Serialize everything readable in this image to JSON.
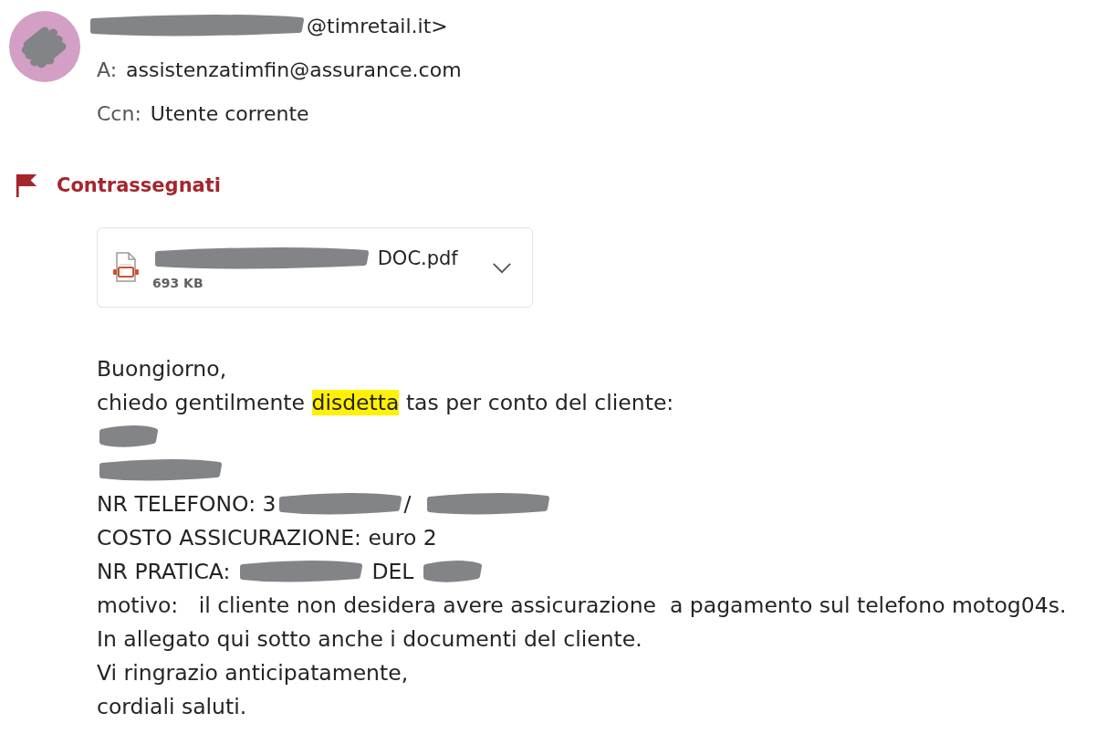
{
  "header": {
    "avatar": {
      "color": "#d39fc4",
      "redacted": true
    },
    "from": [
      {
        "kind": "redaction-long"
      },
      {
        "kind": "text",
        "text": "@timretail.it>"
      }
    ],
    "recipients": [
      {
        "label": "A:",
        "value": "assistenzatimfin@assurance.com"
      },
      {
        "label": "Ccn:",
        "value": "Utente corrente"
      }
    ]
  },
  "flag": {
    "label": "Contrassegnati",
    "color": "#a4262c"
  },
  "attachment": {
    "name": [
      {
        "kind": "redaction-long"
      },
      {
        "kind": "text",
        "text": " DOC.pdf"
      }
    ],
    "size": "693 KB"
  },
  "body": [
    {
      "segments": [
        {
          "kind": "text",
          "text": "Buongiorno,"
        }
      ]
    },
    {
      "segments": [
        {
          "kind": "text",
          "text": "chiedo gentilmente "
        },
        {
          "kind": "highlight",
          "text": "disdetta"
        },
        {
          "kind": "text",
          "text": " tas per conto del cliente:"
        }
      ]
    },
    {
      "segments": [
        {
          "kind": "redaction-short"
        }
      ]
    },
    {
      "segments": [
        {
          "kind": "redaction-medium"
        }
      ]
    },
    {
      "segments": [
        {
          "kind": "text",
          "text": "NR TELEFONO: 3"
        },
        {
          "kind": "redaction-medium"
        },
        {
          "kind": "text",
          "text": "/  "
        },
        {
          "kind": "redaction-medium"
        }
      ]
    },
    {
      "segments": [
        {
          "kind": "text",
          "text": "COSTO ASSICURAZIONE: euro 2"
        }
      ]
    },
    {
      "segments": [
        {
          "kind": "text",
          "text": "NR PRATICA: "
        },
        {
          "kind": "redaction-medium"
        },
        {
          "kind": "text",
          "text": " DEL "
        },
        {
          "kind": "redaction-short"
        }
      ]
    },
    {
      "segments": [
        {
          "kind": "text",
          "text": "motivo:   il cliente non desidera avere assicurazione  a pagamento sul telefono motog04s."
        }
      ]
    },
    {
      "segments": [
        {
          "kind": "text",
          "text": "In allegato qui sotto anche i documenti del cliente."
        }
      ]
    },
    {
      "segments": [
        {
          "kind": "text",
          "text": "Vi ringrazio anticipatamente,"
        }
      ]
    },
    {
      "segments": [
        {
          "kind": "text",
          "text": "cordiali saluti."
        }
      ]
    }
  ]
}
